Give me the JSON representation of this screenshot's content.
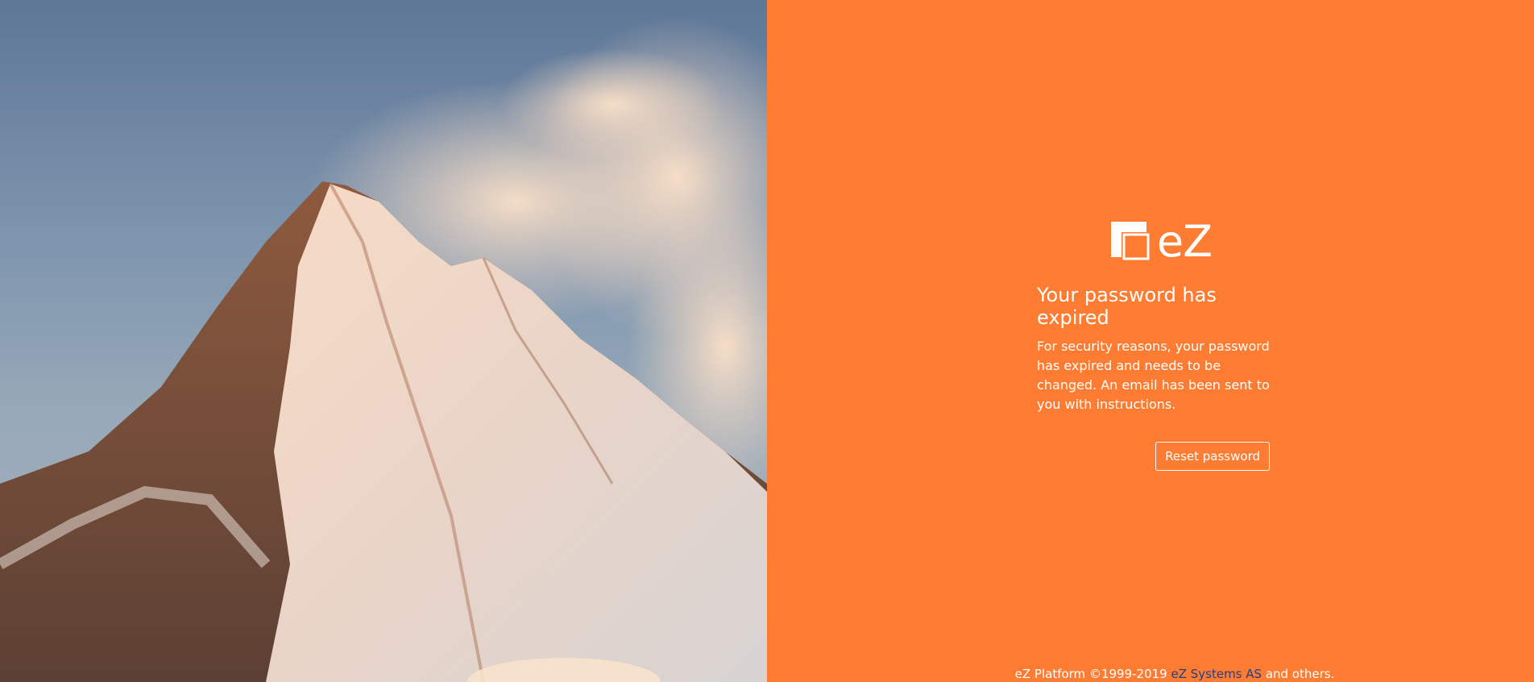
{
  "branding": {
    "logo_text": "eZ"
  },
  "message": {
    "title": "Your password has expired",
    "body": "For security reasons, your password has expired and needs to be changed. An email has been sent to you with instructions."
  },
  "actions": {
    "reset_label": "Reset password"
  },
  "footer": {
    "prefix": "eZ Platform ©1999-2019 ",
    "link_text": "eZ Systems AS",
    "suffix": " and others."
  },
  "colors": {
    "panel_background": "#ff7c32",
    "text": "#ffffff",
    "footer_link": "#1f3f8a"
  },
  "icons": {
    "logo": "ez-logo-icon",
    "hero": "mountain-peak-image"
  }
}
